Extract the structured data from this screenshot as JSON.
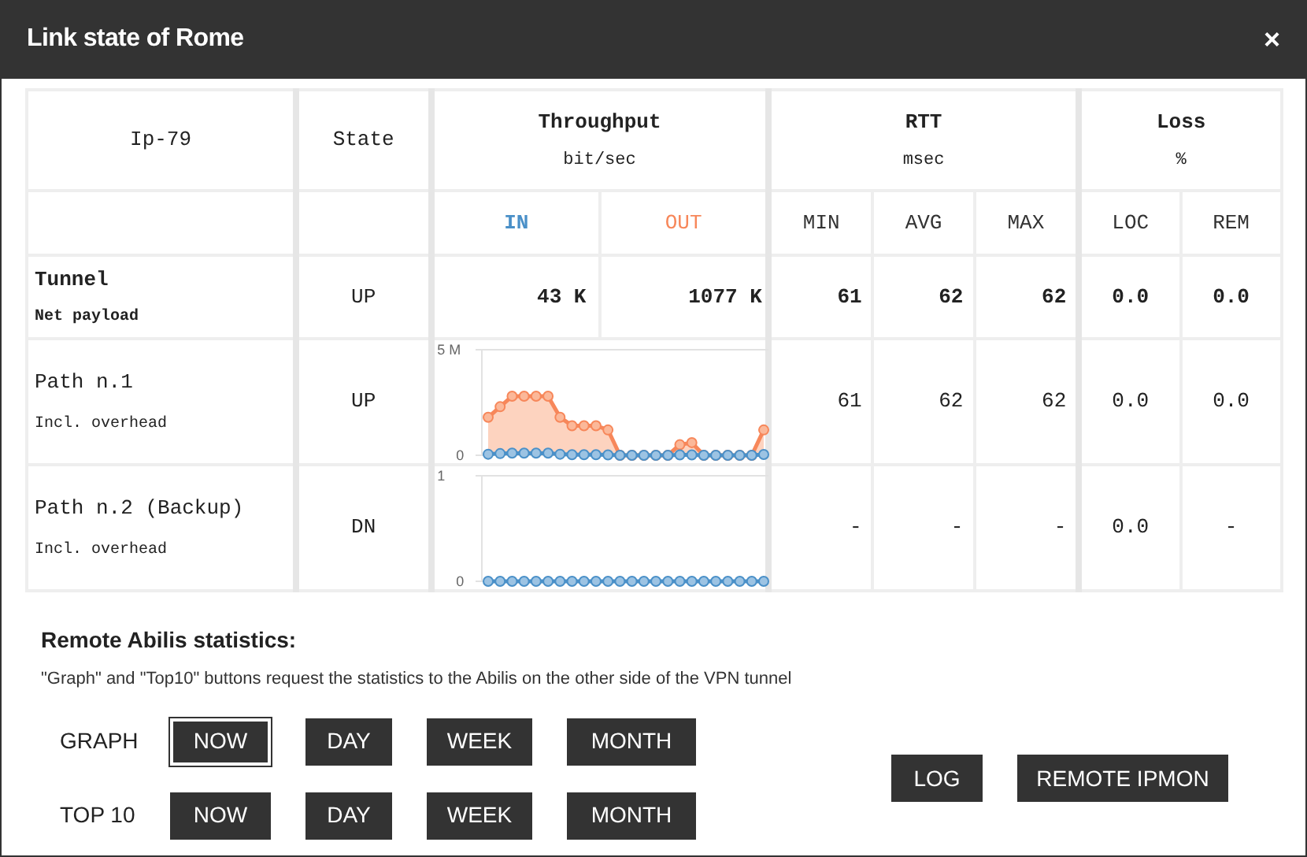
{
  "window": {
    "title": "Link state of Rome",
    "close": "×"
  },
  "table": {
    "columns": {
      "name": "Ip-79",
      "state": "State",
      "throughput": {
        "label": "Throughput",
        "unit": "bit/sec",
        "in": "IN",
        "out": "OUT"
      },
      "rtt": {
        "label": "RTT",
        "unit": "msec",
        "min": "MIN",
        "avg": "AVG",
        "max": "MAX"
      },
      "loss": {
        "label": "Loss",
        "unit": "%",
        "loc": "LOC",
        "rem": "REM"
      }
    },
    "rows": [
      {
        "kind": "values",
        "name": "Tunnel",
        "subtitle": "Net payload",
        "state": "UP",
        "in": "43 K",
        "out": "1077 K",
        "min": "61",
        "avg": "62",
        "max": "62",
        "loc": "0.0",
        "rem": "0.0"
      },
      {
        "kind": "chart",
        "name": "Path n.1",
        "subtitle": "Incl. overhead",
        "state": "UP",
        "min": "61",
        "avg": "62",
        "max": "62",
        "loc": "0.0",
        "rem": "0.0",
        "graph": {
          "kind": "traffic",
          "top_label": "5 M",
          "bottom_label": "0"
        }
      },
      {
        "kind": "chart",
        "name": "Path n.2 (Backup)",
        "subtitle": "Incl. overhead",
        "state": "DN",
        "min": "-",
        "avg": "-",
        "max": "-",
        "loc": "0.0",
        "rem": "-",
        "graph": {
          "kind": "flat",
          "top_label": "1",
          "bottom_label": "0"
        }
      }
    ]
  },
  "remote": {
    "title": "Remote Abilis statistics:",
    "note": "\"Graph\" and \"Top10\" buttons request the statistics to the Abilis on the other side of the VPN tunnel",
    "groups": [
      {
        "label": "GRAPH",
        "buttons": [
          {
            "label": "NOW",
            "selected": true
          },
          {
            "label": "DAY",
            "selected": false
          },
          {
            "label": "WEEK",
            "selected": false
          },
          {
            "label": "MONTH",
            "selected": false
          }
        ]
      },
      {
        "label": "TOP 10",
        "buttons": [
          {
            "label": "NOW",
            "selected": false
          },
          {
            "label": "DAY",
            "selected": false
          },
          {
            "label": "WEEK",
            "selected": false
          },
          {
            "label": "MONTH",
            "selected": false
          }
        ]
      }
    ],
    "actions": [
      "LOG",
      "REMOTE IPMON"
    ]
  }
}
